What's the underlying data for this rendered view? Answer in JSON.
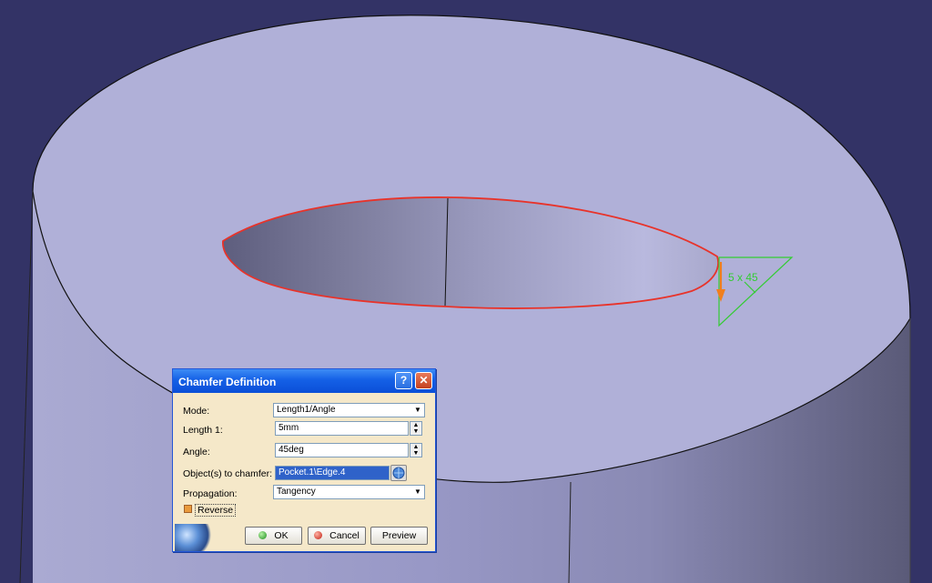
{
  "dialog": {
    "title": "Chamfer Definition",
    "help_glyph": "?",
    "close_glyph": "✕",
    "mode": {
      "label": "Mode:",
      "value": "Length1/Angle"
    },
    "length1": {
      "label": "Length 1:",
      "value": "5mm"
    },
    "angle": {
      "label": "Angle:",
      "value": "45deg"
    },
    "objects": {
      "label": "Object(s) to chamfer:",
      "value": "Pocket.1\\Edge.4"
    },
    "propagation": {
      "label": "Propagation:",
      "value": "Tangency"
    },
    "reverse": {
      "label": "Reverse",
      "checked": false
    },
    "buttons": {
      "ok": "OK",
      "cancel": "Cancel",
      "preview": "Preview"
    }
  },
  "annotation": {
    "chamfer_label": "5 x 45"
  },
  "colors": {
    "background": "#333366",
    "part_face": "#b0b0d8",
    "selected_edge": "#e8332a",
    "annotation": "#33cc33",
    "arrow": "#f07f1d"
  },
  "icons": [
    "help-icon",
    "close-icon",
    "ok-icon",
    "cancel-icon",
    "selection-globe-icon",
    "combo-arrow-icon",
    "spin-icon"
  ]
}
